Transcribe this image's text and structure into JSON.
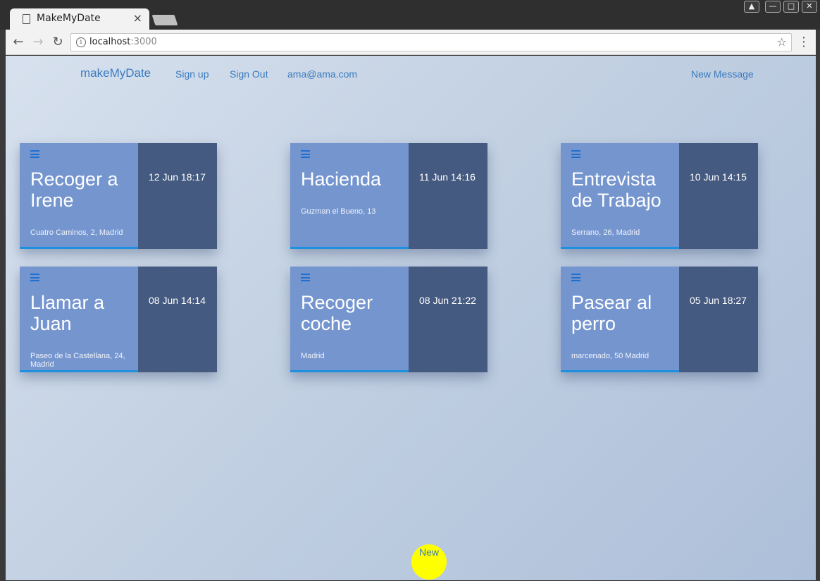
{
  "browser": {
    "tab_title": "MakeMyDate",
    "tab_close": "×",
    "url_host": "localhost",
    "url_port": ":3000",
    "window_controls": [
      "person-icon",
      "minimize-icon",
      "maximize-icon",
      "close-icon"
    ]
  },
  "navbar": {
    "brand": "makeMyDate",
    "links": [
      "Sign up",
      "Sign Out",
      "ama@ama.com"
    ],
    "new_message": "New Message"
  },
  "cards": [
    {
      "title": "Recoger a Irene",
      "address": "Cuatro Caminos, 2, Madrid",
      "date": "12 Jun 18:17"
    },
    {
      "title": "Hacienda",
      "address": "Guzman el Bueno, 13",
      "date": "11 Jun 14:16"
    },
    {
      "title": "Entrevista de Trabajo",
      "address": "Serrano, 26, Madrid",
      "date": "10 Jun 14:15"
    },
    {
      "title": "Llamar a Juan",
      "address": "Paseo de la Castellana, 24, Madrid",
      "date": "08 Jun 14:14"
    },
    {
      "title": "Recoger coche",
      "address": "Madrid",
      "date": "08 Jun 21:22"
    },
    {
      "title": "Pasear al perro",
      "address": "marcenado, 50 Madrid",
      "date": "05 Jun 18:27"
    }
  ],
  "new_button": {
    "label": "New",
    "color": "#ffff00"
  },
  "colors": {
    "card_left": "#7595cf",
    "card_right": "#455a80",
    "accent_bar": "#1e90e0",
    "link": "#3a7bbf"
  }
}
